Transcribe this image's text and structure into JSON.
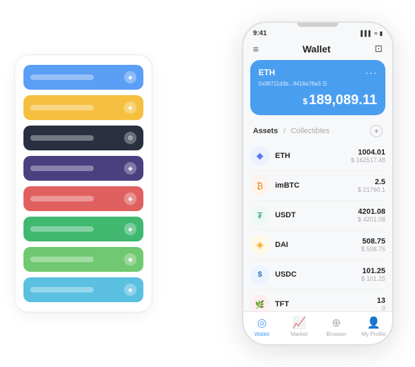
{
  "scene": {
    "cards": [
      {
        "color": "card-blue",
        "icon": "◆"
      },
      {
        "color": "card-yellow",
        "icon": "◆"
      },
      {
        "color": "card-dark",
        "icon": "⚙"
      },
      {
        "color": "card-purple",
        "icon": "◆"
      },
      {
        "color": "card-red",
        "icon": "◆"
      },
      {
        "color": "card-green",
        "icon": "◆"
      },
      {
        "color": "card-light-green",
        "icon": "◆"
      },
      {
        "color": "card-sky",
        "icon": "◆"
      }
    ]
  },
  "phone": {
    "statusBar": {
      "time": "9:41",
      "signal": "▌▌▌",
      "wifi": "WiFi",
      "battery": "🔋"
    },
    "header": {
      "menuIcon": "≡",
      "title": "Wallet",
      "scanIcon": "⊡"
    },
    "ethCard": {
      "name": "ETH",
      "address": "0x08711d3b...8416a78a3 ☰",
      "dots": "···",
      "balanceSymbol": "$",
      "balance": "189,089.11"
    },
    "tabs": {
      "active": "Assets",
      "divider": "/",
      "inactive": "Collectibles",
      "addIcon": "+"
    },
    "assets": [
      {
        "symbol": "ETH",
        "iconClass": "icon-eth",
        "iconText": "◆",
        "amount": "1004.01",
        "usd": "$ 162517.48"
      },
      {
        "symbol": "imBTC",
        "iconClass": "icon-imbtc",
        "iconText": "₿",
        "amount": "2.5",
        "usd": "$ 21760.1"
      },
      {
        "symbol": "USDT",
        "iconClass": "icon-usdt",
        "iconText": "₮",
        "amount": "4201.08",
        "usd": "$ 4201.08"
      },
      {
        "symbol": "DAI",
        "iconClass": "icon-dai",
        "iconText": "◈",
        "amount": "508.75",
        "usd": "$ 508.75"
      },
      {
        "symbol": "USDC",
        "iconClass": "icon-usdc",
        "iconText": "©",
        "amount": "101.25",
        "usd": "$ 101.25"
      },
      {
        "symbol": "TFT",
        "iconClass": "icon-tft",
        "iconText": "🌿",
        "amount": "13",
        "usd": "0"
      }
    ],
    "bottomNav": [
      {
        "id": "wallet",
        "icon": "◎",
        "label": "Wallet",
        "active": true
      },
      {
        "id": "market",
        "icon": "📊",
        "label": "Market",
        "active": false
      },
      {
        "id": "browser",
        "icon": "🌐",
        "label": "Browser",
        "active": false
      },
      {
        "id": "profile",
        "icon": "👤",
        "label": "My Profile",
        "active": false
      }
    ]
  }
}
